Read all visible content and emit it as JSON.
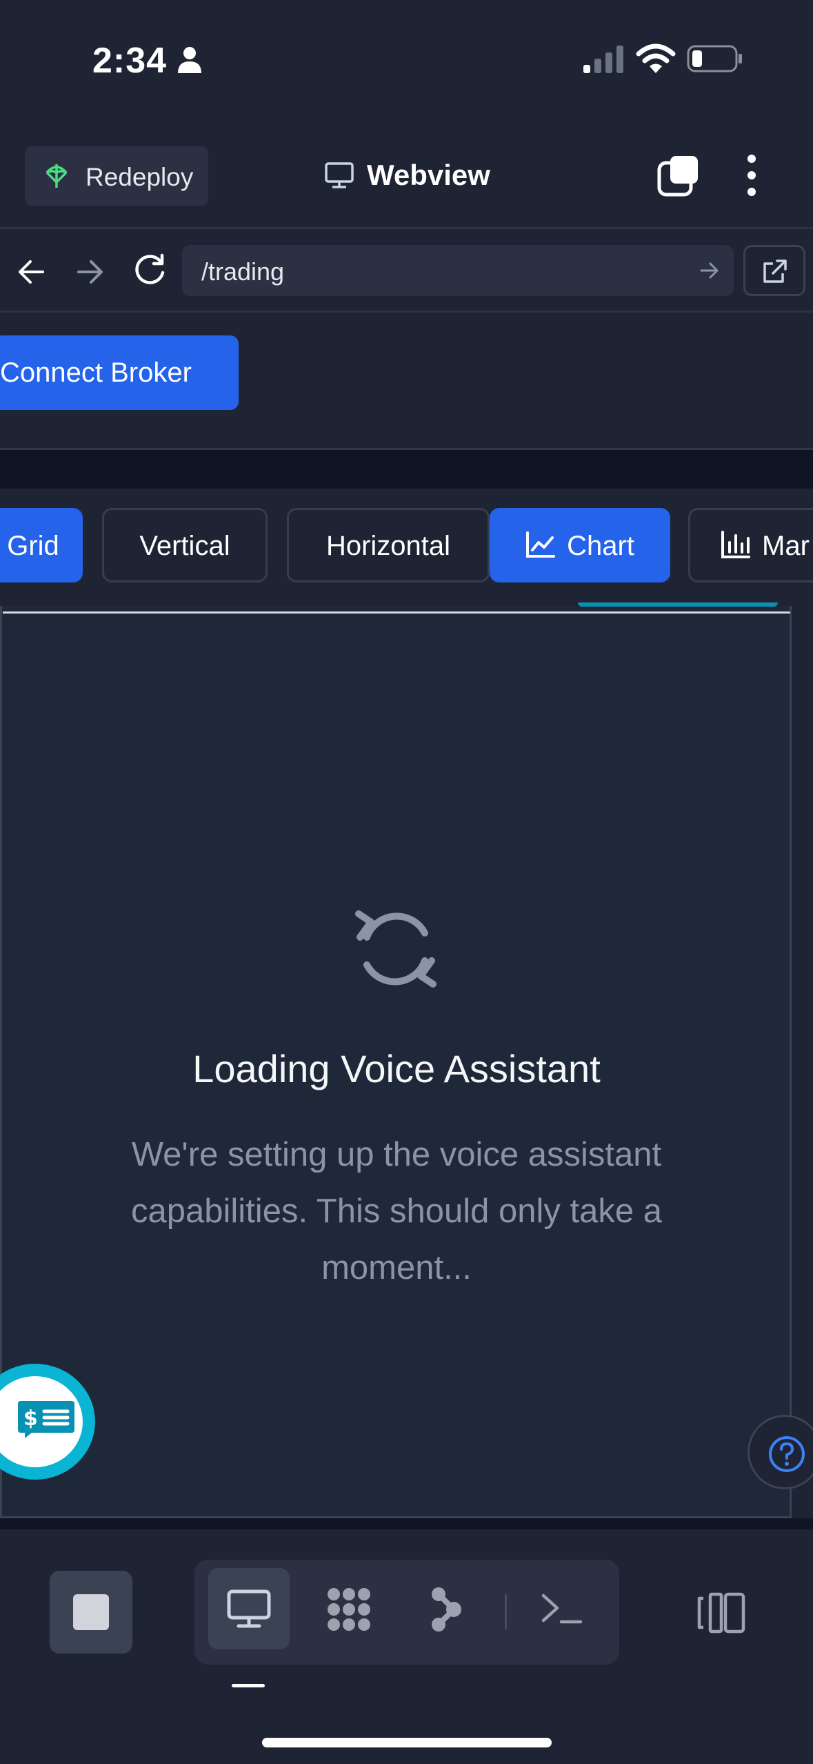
{
  "status_bar": {
    "time": "2:34"
  },
  "toolbar": {
    "redeploy_label": "Redeploy",
    "title": "Webview"
  },
  "urlbar": {
    "url": "/trading"
  },
  "page": {
    "connect_broker_label": "Connect Broker"
  },
  "layout_tabs": [
    {
      "label": "Grid",
      "active": true
    },
    {
      "label": "Vertical",
      "active": false
    },
    {
      "label": "Horizontal",
      "active": false
    },
    {
      "label": "Chart",
      "active": true,
      "icon": "line-chart-icon"
    },
    {
      "label": "Mar",
      "active": false,
      "icon": "bar-chart-icon"
    }
  ],
  "loading": {
    "title": "Loading Voice Assistant",
    "description": "We're setting up the voice assistant capabilities. This should only take a moment..."
  },
  "bottom_nav": {
    "items": [
      "desktop-icon",
      "apps-icon",
      "workflow-icon",
      "terminal-icon"
    ],
    "active": "desktop-icon"
  },
  "colors": {
    "background": "#1e2433",
    "accent_blue": "#2563eb",
    "accent_cyan": "#0ab4d4",
    "muted_text": "#8b94a6"
  }
}
